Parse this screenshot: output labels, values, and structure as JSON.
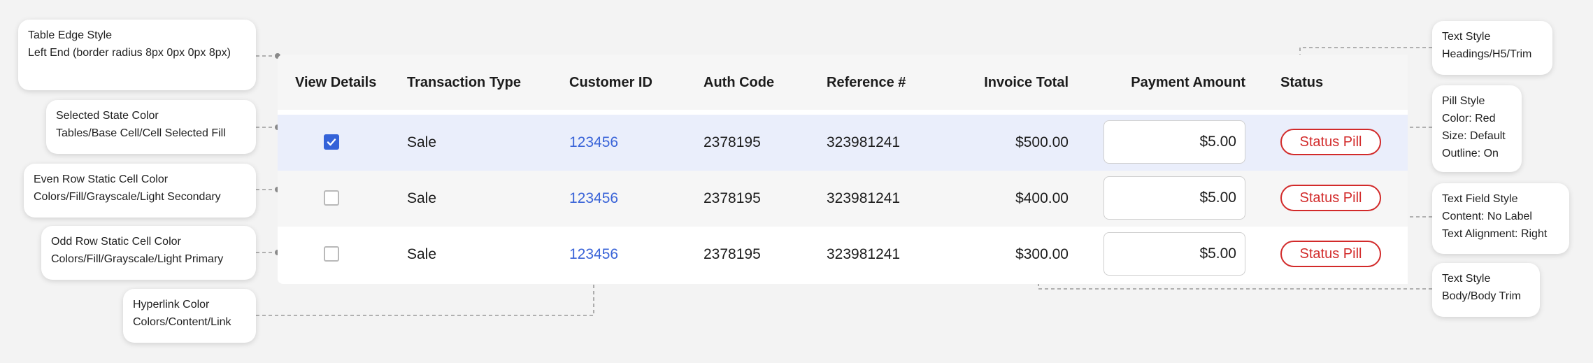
{
  "table": {
    "headers": {
      "view_details": "View Details",
      "transaction_type": "Transaction Type",
      "customer_id": "Customer ID",
      "auth_code": "Auth Code",
      "reference": "Reference #",
      "invoice_total": "Invoice Total",
      "payment_amount": "Payment Amount",
      "status": "Status"
    },
    "rows": [
      {
        "checked": true,
        "state": "selected",
        "transaction_type": "Sale",
        "customer_id": "123456",
        "auth_code": "2378195",
        "reference": "323981241",
        "invoice_total": "$500.00",
        "payment_amount": "$5.00",
        "status": "Status Pill"
      },
      {
        "checked": false,
        "state": "even",
        "transaction_type": "Sale",
        "customer_id": "123456",
        "auth_code": "2378195",
        "reference": "323981241",
        "invoice_total": "$400.00",
        "payment_amount": "$5.00",
        "status": "Status Pill"
      },
      {
        "checked": false,
        "state": "odd",
        "transaction_type": "Sale",
        "customer_id": "123456",
        "auth_code": "2378195",
        "reference": "323981241",
        "invoice_total": "$300.00",
        "payment_amount": "$5.00",
        "status": "Status Pill"
      }
    ]
  },
  "annotations": {
    "table_edge": {
      "line1": "Table Edge Style",
      "line2": "Left End (border radius 8px 0px 0px 8px)"
    },
    "selected_state": {
      "line1": "Selected State Color",
      "line2": "Tables/Base Cell/Cell Selected Fill"
    },
    "even_row": {
      "line1": "Even Row Static Cell Color",
      "line2": "Colors/Fill/Grayscale/Light Secondary"
    },
    "odd_row": {
      "line1": "Odd Row Static Cell Color",
      "line2": "Colors/Fill/Grayscale/Light Primary"
    },
    "hyperlink": {
      "line1": "Hyperlink Color",
      "line2": "Colors/Content/Link"
    },
    "heading_text": {
      "line1": "Text Style",
      "line2": "Headings/H5/Trim"
    },
    "pill": {
      "line1": "Pill Style",
      "line2": "Color: Red",
      "line3": "Size: Default",
      "line4": "Outline: On"
    },
    "text_field": {
      "line1": "Text Field Style",
      "line2": "Content: No Label",
      "line3": "Text Alignment: Right"
    },
    "body_text": {
      "line1": "Text Style",
      "line2": "Body/Body Trim"
    }
  },
  "colors": {
    "background": "#f3f3f3",
    "header_fill": "#f6f6f6",
    "selected_fill": "#eaeefb",
    "even_fill": "#f6f6f6",
    "odd_fill": "#ffffff",
    "link": "#3a64d8",
    "checkbox_checked": "#3462d8",
    "pill_red": "#d22a2a",
    "leader_line": "#9a9a9a"
  },
  "icons": {
    "checkbox_checked": "checkmark-icon"
  }
}
